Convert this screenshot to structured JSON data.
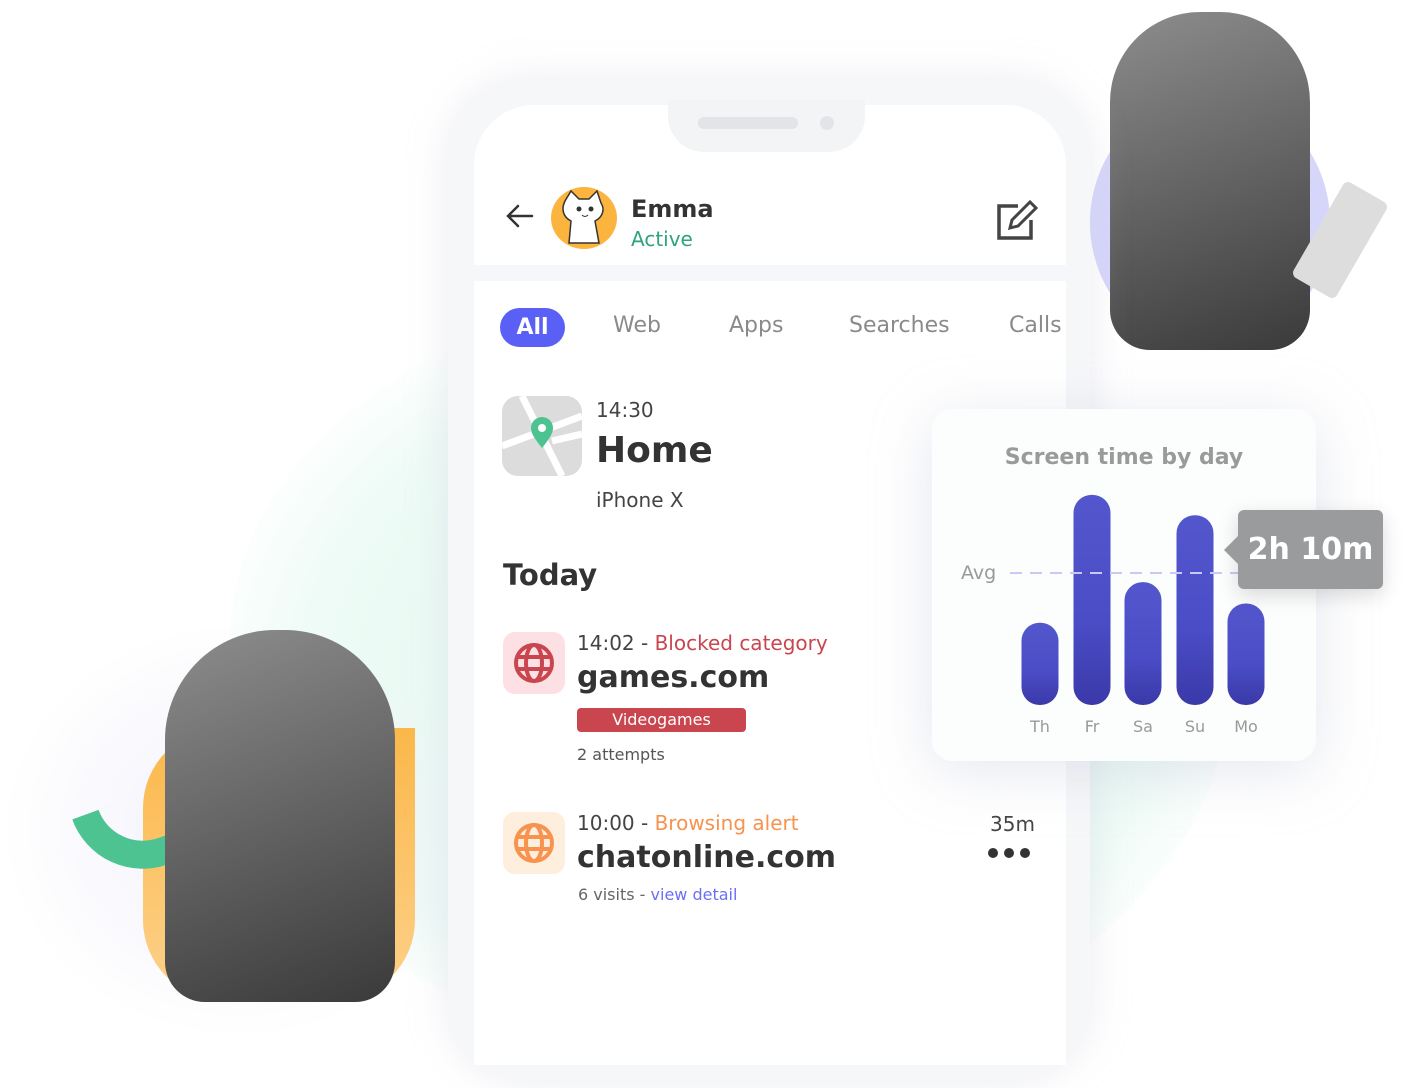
{
  "header": {
    "back_icon": "arrow-left-icon",
    "name": "Emma",
    "status": "Active",
    "edit_icon": "edit-icon"
  },
  "tabs": [
    {
      "label": "All",
      "active": true
    },
    {
      "label": "Web"
    },
    {
      "label": "Apps"
    },
    {
      "label": "Searches"
    },
    {
      "label": "Calls"
    }
  ],
  "location": {
    "time": "14:30",
    "place": "Home",
    "device": "iPhone X",
    "icon": "map-pin-icon"
  },
  "today": {
    "title": "Today",
    "items": [
      {
        "time": "14:02",
        "separator": " - ",
        "alert": "Blocked category",
        "alert_color": "#c9464f",
        "site": "games.com",
        "badge": "Videogames",
        "detail": "2 attempts",
        "icon": "globe-icon"
      },
      {
        "time": "10:00",
        "separator": " - ",
        "alert": "Browsing alert",
        "alert_color": "#f7924f",
        "site": "chatonline.com",
        "duration": "35m",
        "detail": "6 visits",
        "detail_sep": " - ",
        "link": "view detail",
        "more_icon": "more-dots-icon"
      }
    ]
  },
  "colors": {
    "accent": "#5a5ff5",
    "active": "#2fa37c",
    "bar": "#4b4fc8"
  },
  "chart_data": {
    "type": "bar",
    "title": "Screen time by day",
    "categories": [
      "Th",
      "Fr",
      "Sa",
      "Su",
      "Mo"
    ],
    "values": [
      81,
      207,
      121,
      187,
      100
    ],
    "unit": "minutes",
    "avg_label": "Avg",
    "avg_value": 130,
    "tooltip": "2h 10m",
    "grid": false
  }
}
